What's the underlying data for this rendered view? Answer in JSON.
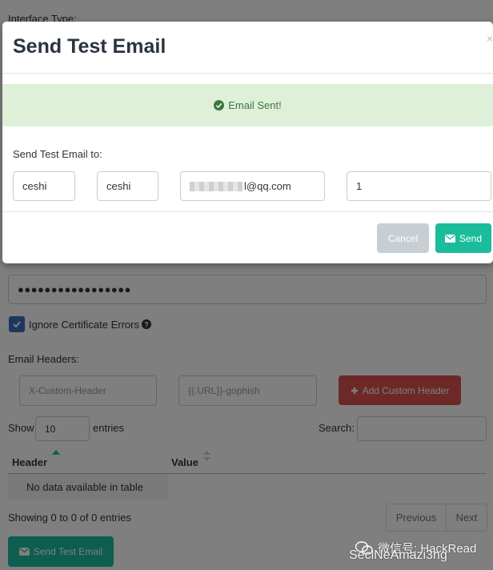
{
  "background": {
    "interface_type_label": "Interface Type:",
    "password_mask": "●●●●●●●●●●●●●●●●●",
    "ignore_cert_label": "Ignore Certificate Errors",
    "email_headers_label": "Email Headers:",
    "header_name_placeholder": "X-Custom-Header",
    "header_value_placeholder": "{{.URL}}-gophish",
    "add_header_button": "Add Custom Header",
    "show_label": "Show",
    "entries_value": "10",
    "entries_label": "entries",
    "search_label": "Search:",
    "search_value": "",
    "table_headers": [
      "Header",
      "Value"
    ],
    "empty_row": "No data available in table",
    "showing_text": "Showing 0 to 0 of 0 entries",
    "previous_label": "Previous",
    "next_label": "Next",
    "send_test_email_button": "Send Test Email"
  },
  "modal": {
    "title": "Send Test Email",
    "close_glyph": "×",
    "alert_text": "Email Sent!",
    "send_to_label": "Send Test Email to:",
    "first_name": "ceshi",
    "last_name": "ceshi",
    "email_suffix": "l@qq.com",
    "position": "1",
    "cancel_button": "Cancel",
    "send_button": "Send"
  },
  "watermark": {
    "line1": "微信号: HackRead",
    "line2": "SeclNeAmazi3ng"
  },
  "colors": {
    "accent_green": "#1abc9c",
    "danger_red": "#d9534f",
    "checkbox_blue": "#3b6fbf",
    "alert_bg": "#dff0d8"
  }
}
